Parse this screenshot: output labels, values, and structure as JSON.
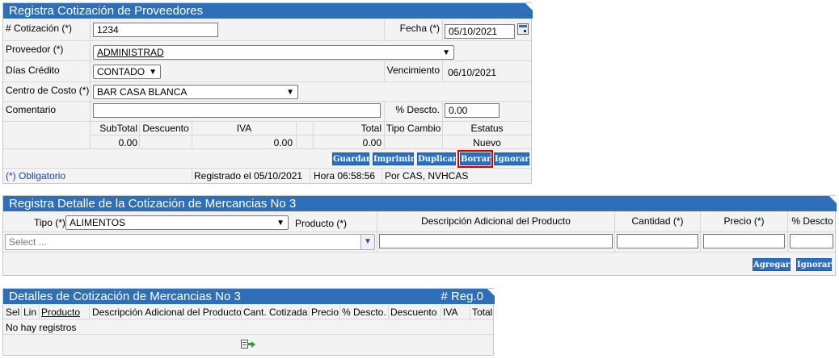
{
  "cotizacion": {
    "title": "Registra Cotización de Proveedores",
    "labels": {
      "numero": "# Cotización (*)",
      "fecha": "Fecha (*)",
      "proveedor": "Proveedor (*)",
      "dias_credito": "Días Crédito",
      "vencimiento": "Vencimiento",
      "centro_costo": "Centro de Costo (*)",
      "comentario": "Comentario",
      "pct_descto": "% Descto."
    },
    "values": {
      "numero": "1234",
      "fecha": "05/10/2021",
      "proveedor": "ADMINISTRAD",
      "dias_credito": "CONTADO",
      "vencimiento": "06/10/2021",
      "centro_costo": "BAR CASA BLANCA",
      "comentario": "",
      "pct_descto": "0.00"
    },
    "totals_headers": [
      "SubTotal",
      "Descuento",
      "IVA",
      "Total",
      "Tipo Cambio",
      "Estatus"
    ],
    "totals_values": {
      "subtotal": "0.00",
      "descuento": "",
      "iva": "0.00",
      "total": "0.00",
      "tipo_cambio": "",
      "estatus": "Nuevo"
    },
    "buttons": {
      "guardar": "Guardar",
      "imprimir": "Imprimir",
      "duplicar": "Duplicar",
      "borrar": "Borrar",
      "ignorar": "Ignorar"
    },
    "footer": {
      "obligatorio": "(*) Obligatorio",
      "registrado": "Registrado el 05/10/2021",
      "hora": "Hora 06:58:56",
      "por": "Por CAS, NVHCAS"
    }
  },
  "detalle": {
    "title": "Registra Detalle de la Cotización de Mercancias No 3",
    "labels": {
      "tipo": "Tipo (*)",
      "producto": "Producto (*)",
      "descripcion": "Descripción Adicional del Producto",
      "cantidad": "Cantidad (*)",
      "precio": "Precio (*)",
      "pct_descto": "% Descto"
    },
    "values": {
      "tipo": "ALIMENTOS",
      "producto_placeholder": "Select ..."
    },
    "buttons": {
      "agregar": "Agregar",
      "ignorar": "Ignorar"
    }
  },
  "lista": {
    "title": "Detalles de Cotización de Mercancias No 3",
    "reg": "# Reg.0",
    "columns": [
      "Sel",
      "Lin",
      "Producto",
      "Descripción Adicional del Producto",
      "Cant. Cotizada",
      "Precio",
      "% Descto.",
      "Descuento",
      "IVA",
      "Total"
    ],
    "empty": "No hay registros"
  },
  "colors": {
    "header_blue": "#2f6fb8",
    "button_blue": "#2a6fc0",
    "highlight_red": "#d40000"
  }
}
